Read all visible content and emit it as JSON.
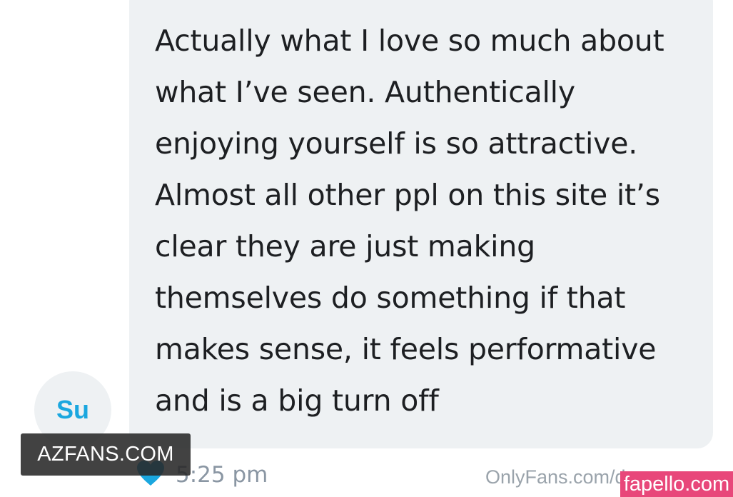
{
  "message": {
    "lines": [
      "Actually what I love so much about",
      "what I’ve seen. Authentically",
      "enjoying yourself is so attractive.",
      "Almost all other ppl on this site it’s",
      "clear they are just making",
      "themselves do something if that",
      "makes sense, it feels performative",
      "and is a big turn off"
    ],
    "time": "5:25 pm",
    "like_icon": "heart-icon",
    "like_color": "#1aa7df"
  },
  "avatar": {
    "initials": "Su",
    "color": "#1aa7df"
  },
  "watermarks": {
    "left": "AZFANS.COM",
    "right": "fapello.com",
    "url": "OnlyFans.com/d...",
    "right_color": "#e8477a"
  },
  "colors": {
    "bubble_bg": "#eef1f3",
    "text": "#1d1f22",
    "muted": "#8a96a3"
  }
}
